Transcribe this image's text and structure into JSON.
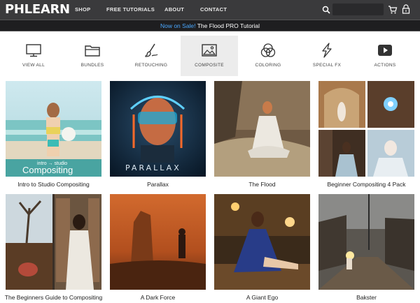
{
  "brand": {
    "logo": "PHLEARN"
  },
  "nav": {
    "items": [
      "SHOP",
      "FREE TUTORIALS",
      "ABOUT",
      "CONTACT"
    ]
  },
  "search": {
    "placeholder": ""
  },
  "promo": {
    "highlight": "Now on Sale!",
    "text": " The Flood PRO Tutorial"
  },
  "categories": [
    {
      "label": "VIEW ALL",
      "icon": "monitor-icon"
    },
    {
      "label": "BUNDLES",
      "icon": "folder-icon"
    },
    {
      "label": "RETOUCHING",
      "icon": "brush-icon"
    },
    {
      "label": "COMPOSITE",
      "icon": "image-icon",
      "active": true
    },
    {
      "label": "COLORING",
      "icon": "color-circles-icon"
    },
    {
      "label": "SPECIAL FX",
      "icon": "lightning-icon"
    },
    {
      "label": "ACTIONS",
      "icon": "play-icon"
    }
  ],
  "products": [
    {
      "title": "Intro to Studio Compositing",
      "overlay_small": "intro → studio",
      "overlay_big": "Compositing"
    },
    {
      "title": "Parallax",
      "overlay_big": "PARALLAX"
    },
    {
      "title": "The Flood"
    },
    {
      "title": "Beginner Compositing 4 Pack"
    },
    {
      "title": "The Beginners Guide to Compositing"
    },
    {
      "title": "A Dark Force"
    },
    {
      "title": "A Giant Ego"
    },
    {
      "title": "Bakster"
    }
  ],
  "colors": {
    "topbar": "#3a3a3c",
    "promo_bg": "#1e1e20",
    "promo_highlight": "#4aa8ff",
    "active_category": "#ececec"
  }
}
